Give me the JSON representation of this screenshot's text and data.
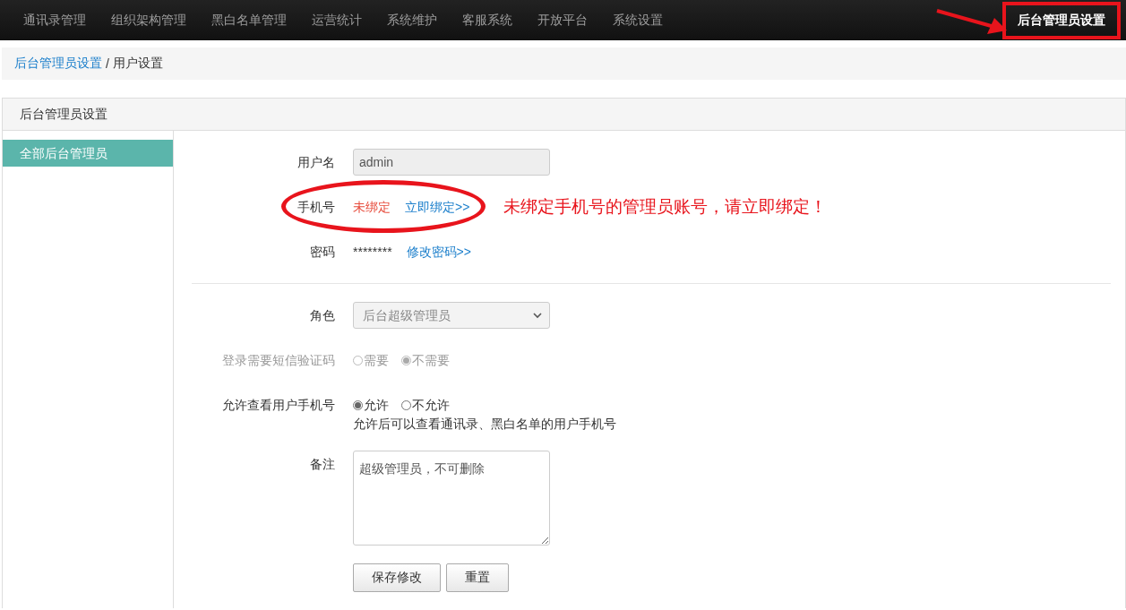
{
  "nav": {
    "items": [
      {
        "label": "通讯录管理",
        "selected": false
      },
      {
        "label": "组织架构管理",
        "selected": false
      },
      {
        "label": "黑白名单管理",
        "selected": false
      },
      {
        "label": "运营统计",
        "selected": false
      },
      {
        "label": "系统维护",
        "selected": false
      },
      {
        "label": "客服系统",
        "selected": false
      },
      {
        "label": "开放平台",
        "selected": false
      },
      {
        "label": "系统设置",
        "selected": false
      },
      {
        "label": "后台管理员设置",
        "selected": true
      }
    ]
  },
  "breadcrumb": {
    "link": "后台管理员设置",
    "separator": "/",
    "current": "用户设置"
  },
  "panel": {
    "title": "后台管理员设置"
  },
  "sidebar": {
    "items": [
      {
        "label": "全部后台管理员",
        "selected": true
      }
    ]
  },
  "form": {
    "rows": [
      {
        "kind": "input",
        "label": "用户名",
        "value": "admin",
        "disabled": true
      },
      {
        "kind": "status",
        "label": "手机号",
        "status": "未绑定",
        "link": "立即绑定>>"
      },
      {
        "kind": "masked",
        "label": "密码",
        "value": "********",
        "link": "修改密码>>"
      },
      {
        "kind": "divider"
      },
      {
        "kind": "select",
        "label": "角色",
        "value": "后台超级管理员",
        "disabled": true
      },
      {
        "kind": "radio",
        "label": "登录需要短信验证码",
        "disabled": true,
        "options": [
          {
            "label": "需要",
            "selected": false
          },
          {
            "label": "不需要",
            "selected": true
          }
        ]
      },
      {
        "kind": "radio",
        "label": "允许查看用户手机号",
        "disabled": false,
        "options": [
          {
            "label": "允许",
            "selected": true
          },
          {
            "label": "不允许",
            "selected": false
          }
        ],
        "hint": "允许后可以查看通讯录、黑白名单的用户手机号"
      },
      {
        "kind": "textarea",
        "label": "备注",
        "value": "超级管理员，不可删除"
      }
    ],
    "buttons": [
      "保存修改",
      "重置"
    ]
  },
  "annotation": {
    "text": "未绑定手机号的管理员账号，请立即绑定！"
  }
}
